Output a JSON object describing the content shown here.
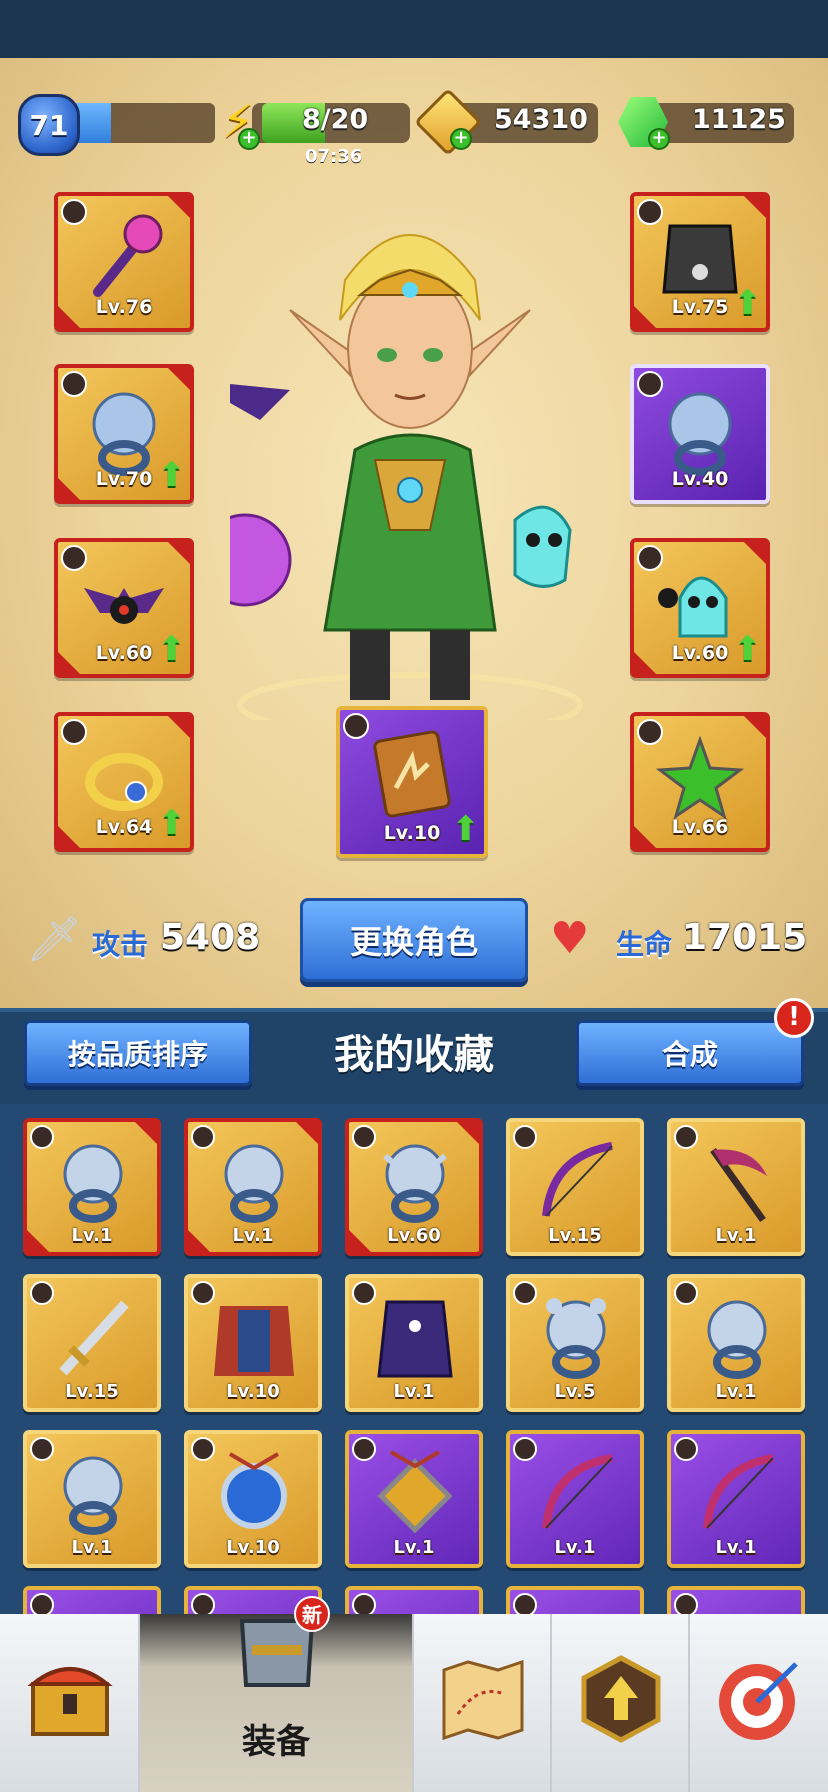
{
  "resources": {
    "player_level": "71",
    "xp_fill_fraction": 0.28,
    "energy": "8/20",
    "energy_fill_fraction": 0.4,
    "energy_timer": "07:36",
    "gold": "54310",
    "gems": "11125"
  },
  "equipped": {
    "left": [
      {
        "slot": "weapon",
        "level": "Lv.76",
        "quality": "red",
        "upgrade": false
      },
      {
        "slot": "ring",
        "level": "Lv.70",
        "quality": "red",
        "upgrade": true
      },
      {
        "slot": "pet",
        "level": "Lv.60",
        "quality": "red",
        "upgrade": true
      },
      {
        "slot": "bracelet",
        "level": "Lv.64",
        "quality": "red",
        "upgrade": true
      }
    ],
    "right": [
      {
        "slot": "armor",
        "level": "Lv.75",
        "quality": "red",
        "upgrade": true
      },
      {
        "slot": "ring",
        "level": "Lv.40",
        "quality": "purple",
        "upgrade": false
      },
      {
        "slot": "pet",
        "level": "Lv.60",
        "quality": "red",
        "upgrade": true
      },
      {
        "slot": "amulet",
        "level": "Lv.66",
        "quality": "red",
        "upgrade": false
      }
    ],
    "center": {
      "slot": "spellbook",
      "level": "Lv.10",
      "quality": "purple",
      "upgrade": true
    }
  },
  "stats": {
    "attack_label": "攻击",
    "attack_value": "5408",
    "hp_label": "生命",
    "hp_value": "17015"
  },
  "buttons": {
    "change_hero": "更换角色",
    "sort_quality": "按品质排序",
    "merge": "合成",
    "merge_alert": "!"
  },
  "collection": {
    "title": "我的收藏",
    "rows": [
      [
        {
          "item": "wolf-ring",
          "level": "Lv.1",
          "quality": "red"
        },
        {
          "item": "eagle-ring",
          "level": "Lv.1",
          "quality": "red"
        },
        {
          "item": "bull-ring",
          "level": "Lv.60",
          "quality": "red"
        },
        {
          "item": "bow",
          "level": "Lv.15",
          "quality": "gold"
        },
        {
          "item": "scythe",
          "level": "Lv.1",
          "quality": "gold"
        }
      ],
      [
        {
          "item": "sword",
          "level": "Lv.15",
          "quality": "gold"
        },
        {
          "item": "cape-armor",
          "level": "Lv.10",
          "quality": "gold"
        },
        {
          "item": "robe-armor",
          "level": "Lv.1",
          "quality": "gold"
        },
        {
          "item": "bear-ring",
          "level": "Lv.5",
          "quality": "gold"
        },
        {
          "item": "eagle-ring",
          "level": "Lv.1",
          "quality": "gold"
        }
      ],
      [
        {
          "item": "eagle-ring",
          "level": "Lv.1",
          "quality": "gold"
        },
        {
          "item": "eagle-amulet",
          "level": "Lv.10",
          "quality": "gold"
        },
        {
          "item": "lion-amulet",
          "level": "Lv.1",
          "quality": "purple"
        },
        {
          "item": "bow",
          "level": "Lv.1",
          "quality": "purple"
        },
        {
          "item": "bow",
          "level": "Lv.1",
          "quality": "purple"
        }
      ]
    ]
  },
  "nav": {
    "items": [
      "chest-icon",
      "armor-icon",
      "map-icon",
      "upgrade-icon",
      "target-icon"
    ],
    "active_label": "装备",
    "new_badge": "新"
  },
  "colors": {
    "legendary_border": "#c7211e",
    "epic_bg": "#7a3ad0",
    "button_blue": "#2f6fd6",
    "upgrade_green": "#4fd13a"
  }
}
